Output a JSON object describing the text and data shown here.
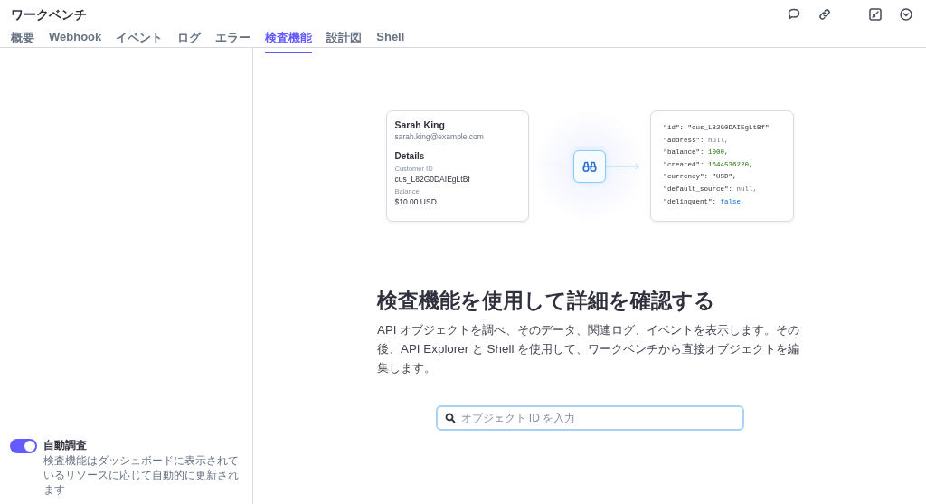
{
  "window": {
    "title": "ワークベンチ"
  },
  "tabs": [
    {
      "label": "概要",
      "selected": false
    },
    {
      "label": "Webhook",
      "selected": false
    },
    {
      "label": "イベント",
      "selected": false
    },
    {
      "label": "ログ",
      "selected": false
    },
    {
      "label": "エラー",
      "selected": false
    },
    {
      "label": "検査機能",
      "selected": true
    },
    {
      "label": "設計図",
      "selected": false
    },
    {
      "label": "Shell",
      "selected": false
    }
  ],
  "customer_card": {
    "name": "Sarah King",
    "email": "sarah.king@example.com",
    "section": "Details",
    "fields": [
      {
        "label": "Customer ID",
        "value": "cus_L82G0DAIEgLtBf"
      },
      {
        "label": "Balance",
        "value": "$10.00 USD"
      }
    ]
  },
  "json_card": {
    "lines": [
      {
        "key": "\"id\":",
        "value": "\"cus_L82G0DAIEgLtBf\"",
        "kind": "string"
      },
      {
        "key": "\"address\":",
        "value": "null,",
        "kind": "null"
      },
      {
        "key": "\"balance\":",
        "value": "1000,",
        "kind": "number"
      },
      {
        "key": "\"created\":",
        "value": "1644536220,",
        "kind": "number"
      },
      {
        "key": "\"currency\":",
        "value": "\"USD\",",
        "kind": "string"
      },
      {
        "key": "\"default_source\":",
        "value": "null,",
        "kind": "null"
      },
      {
        "key": "\"delinquent\":",
        "value": "false,",
        "kind": "boolean"
      }
    ]
  },
  "heading": "検査機能を使用して詳細を確認する",
  "description": "API オブジェクトを調べ、そのデータ、関連ログ、イベントを表示します。その後、API Explorer と Shell を使用して、ワークベンチから直接オブジェクトを編集します。",
  "search": {
    "placeholder": "オブジェクト ID を入力"
  },
  "auto_inspect": {
    "label": "自動調査",
    "on": true,
    "description": "検査機能はダッシュボードに表示されているリソースに応じて自動的に更新されます"
  }
}
